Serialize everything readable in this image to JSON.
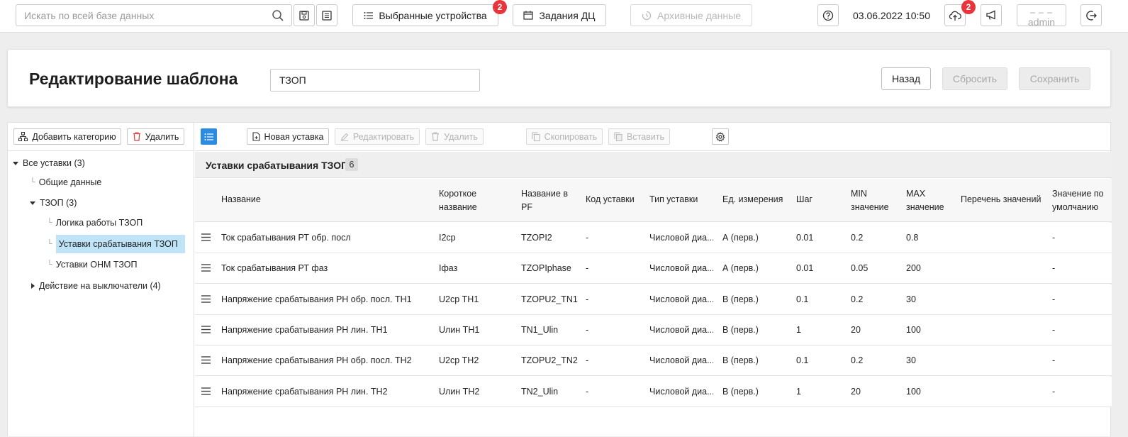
{
  "topbar": {
    "search_placeholder": "Искать по всей базе данных",
    "selected_devices_label": "Выбранные устройства",
    "selected_devices_badge": "2",
    "tasks_label": "Задания ДЦ",
    "archive_label": "Архивные данные",
    "datetime": "03.06.2022 10:50",
    "upload_badge": "2",
    "user_dashes": "– – –",
    "user_name": "admin"
  },
  "header": {
    "title": "Редактирование шаблона",
    "template_name": "ТЗОП",
    "back_label": "Назад",
    "reset_label": "Сбросить",
    "save_label": "Сохранить"
  },
  "tree": {
    "add_category_label": "Добавить категорию",
    "delete_label": "Удалить",
    "nodes": [
      {
        "label": "Все уставки (3)"
      },
      {
        "label": "Общие данные"
      },
      {
        "label": "ТЗОП (3)"
      },
      {
        "label": "Логика работы ТЗОП"
      },
      {
        "label": "Уставки срабатывания ТЗОП"
      },
      {
        "label": "Уставки ОНМ ТЗОП"
      },
      {
        "label": "Действие на выключатели (4)"
      }
    ]
  },
  "toolbar": {
    "new_label": "Новая уставка",
    "edit_label": "Редактировать",
    "delete_label": "Удалить",
    "copy_label": "Скопировать",
    "paste_label": "Вставить"
  },
  "section": {
    "title": "Уставки срабатывания ТЗОП",
    "count": "6"
  },
  "table": {
    "columns": [
      {
        "l1": "Название",
        "l2": ""
      },
      {
        "l1": "Короткое",
        "l2": "название"
      },
      {
        "l1": "Название в",
        "l2": "PF"
      },
      {
        "l1": "Код уставки",
        "l2": ""
      },
      {
        "l1": "Тип уставки",
        "l2": ""
      },
      {
        "l1": "Ед. измерения",
        "l2": ""
      },
      {
        "l1": "Шаг",
        "l2": ""
      },
      {
        "l1": "MIN",
        "l2": "значение"
      },
      {
        "l1": "MAX",
        "l2": "значение"
      },
      {
        "l1": "Перечень значений",
        "l2": ""
      },
      {
        "l1": "Значение по",
        "l2": "умолчанию"
      }
    ],
    "rows": [
      [
        "Ток срабатывания РТ обр. посл",
        "I2ср",
        "TZOPI2",
        "-",
        "Числовой диа...",
        "А (перв.)",
        "0.01",
        "0.2",
        "0.8",
        "",
        "-"
      ],
      [
        "Ток срабатывания РТ фаз",
        "Iфаз",
        "TZOPIphase",
        "-",
        "Числовой диа...",
        "А (перв.)",
        "0.01",
        "0.05",
        "200",
        "",
        "-"
      ],
      [
        "Напряжение срабатывания РН обр. посл. ТН1",
        "U2ср ТН1",
        "TZOPU2_TN1",
        "-",
        "Числовой диа...",
        "В (перв.)",
        "0.1",
        "0.2",
        "30",
        "",
        "-"
      ],
      [
        "Напряжение срабатывания РН лин. ТН1",
        "Uлин ТН1",
        "TN1_Ulin",
        "-",
        "Числовой диа...",
        "В (перв.)",
        "1",
        "20",
        "100",
        "",
        "-"
      ],
      [
        "Напряжение срабатывания РН обр. посл. ТН2",
        "U2ср ТН2",
        "TZOPU2_TN2",
        "-",
        "Числовой диа...",
        "В (перв.)",
        "0.1",
        "0.2",
        "30",
        "",
        "-"
      ],
      [
        "Напряжение срабатывания РН лин. ТН2",
        "Uлин ТН2",
        "TN2_Ulin",
        "-",
        "Числовой диа...",
        "В (перв.)",
        "1",
        "20",
        "100",
        "",
        "-"
      ]
    ]
  },
  "colors": {
    "accent": "#2b8ce0",
    "badge": "#e8343b",
    "selected_row": "#bfe4f7"
  }
}
